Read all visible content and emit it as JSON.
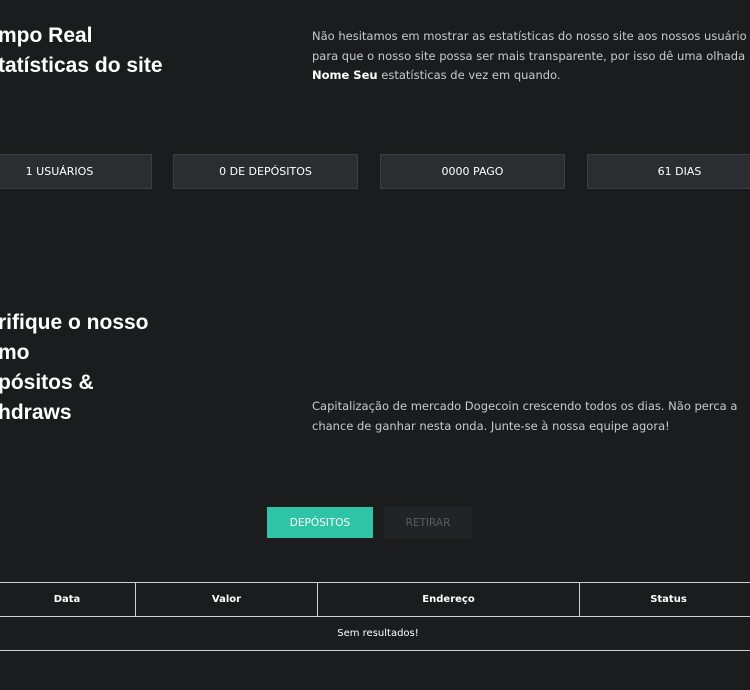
{
  "stats_section": {
    "heading_line1": "mpo Real",
    "heading_line2": "tatísticas do site",
    "desc_line1": "Não hesitamos em mostrar as estatísticas do nosso site aos nossos usuário",
    "desc_line2": "para que o nosso site possa ser mais transparente, por isso dê uma olhada",
    "desc_strong": "Nome Seu",
    "desc_line3_rest": " estatísticas de vez em quando."
  },
  "stats": [
    {
      "label": "1 USUÁRIOS"
    },
    {
      "label": "0 DE DEPÓSITOS"
    },
    {
      "label": "0000 PAGO"
    },
    {
      "label": "61 DIAS"
    }
  ],
  "verify_section": {
    "heading_lines": [
      "rifique o nosso",
      "mo",
      "pósitos &",
      "hdraws"
    ],
    "desc_line1": "Capitalização de mercado Dogecoin crescendo todos os dias. Não perca a",
    "desc_line2": "chance de ganhar nesta onda. Junte-se à nossa equipe agora!"
  },
  "tabs": {
    "deposits": "DEPÓSITOS",
    "withdraw": "RETIRAR"
  },
  "table": {
    "columns": [
      "Data",
      "Valor",
      "Endereço",
      "Status"
    ],
    "empty_message": "Sem resultados!"
  },
  "colors": {
    "background": "#1b1c1e",
    "accent": "#2ec4a6",
    "stat_box": "#2b2d30"
  }
}
